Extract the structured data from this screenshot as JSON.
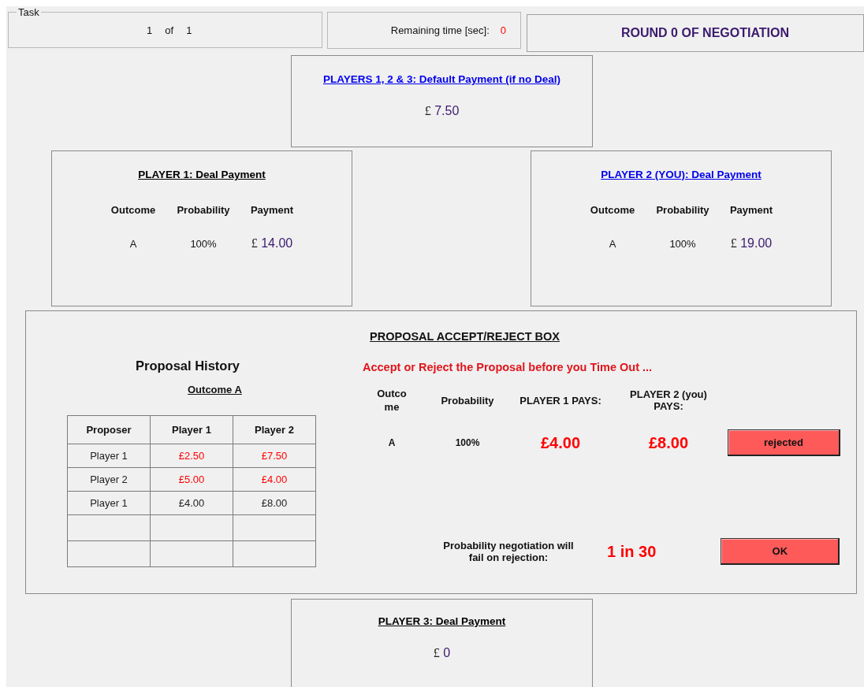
{
  "task": {
    "legend": "Task",
    "current": "1",
    "separator": "of",
    "total": "1"
  },
  "timer": {
    "label": "Remaining time [sec]:",
    "value": "0"
  },
  "round_banner": "ROUND 0 OF NEGOTIATION",
  "default_payment": {
    "title": "PLAYERS 1, 2 & 3: Default Payment (if no Deal)",
    "highlighted": true,
    "currency": "£",
    "amount": "7.50"
  },
  "deal_payments": [
    {
      "title": "PLAYER 1: Deal Payment",
      "highlighted": false,
      "columns": [
        "Outcome",
        "Probability",
        "Payment"
      ],
      "outcome": "A",
      "probability": "100%",
      "currency": "£",
      "amount": "14.00"
    },
    {
      "title": "PLAYER 2 (YOU): Deal Payment",
      "highlighted": true,
      "columns": [
        "Outcome",
        "Probability",
        "Payment"
      ],
      "outcome": "A",
      "probability": "100%",
      "currency": "£",
      "amount": "19.00"
    }
  ],
  "proposal_box": {
    "title": "PROPOSAL ACCEPT/REJECT BOX",
    "history": {
      "title": "Proposal History",
      "subtitle": "Outcome A",
      "columns": [
        "Proposer",
        "Player 1",
        "Player 2"
      ],
      "rows": [
        {
          "cells": [
            "Player 1",
            "£2.50",
            "£7.50"
          ],
          "rejected": true
        },
        {
          "cells": [
            "Player 2",
            "£5.00",
            "£4.00"
          ],
          "rejected": true
        },
        {
          "cells": [
            "Player 1",
            "£4.00",
            "£8.00"
          ],
          "rejected": false
        }
      ]
    },
    "instruction": "Accept or Reject the Proposal before you Time Out ...",
    "columns": [
      "Outcome",
      "Probability",
      "PLAYER 1  PAYS:",
      "PLAYER 2 (you) PAYS:"
    ],
    "proposal": {
      "outcome": "A",
      "probability": "100%",
      "player1_pays": "£4.00",
      "player2_pays": "£8.00"
    },
    "decision_button": "rejected",
    "failure_label": "Probability negotiation will fail on rejection:",
    "failure_odds": "1 in 30",
    "ok_button": "OK"
  },
  "player3_payment": {
    "title": "PLAYER 3: Deal Payment",
    "highlighted": false,
    "currency": "£",
    "amount": "0"
  }
}
